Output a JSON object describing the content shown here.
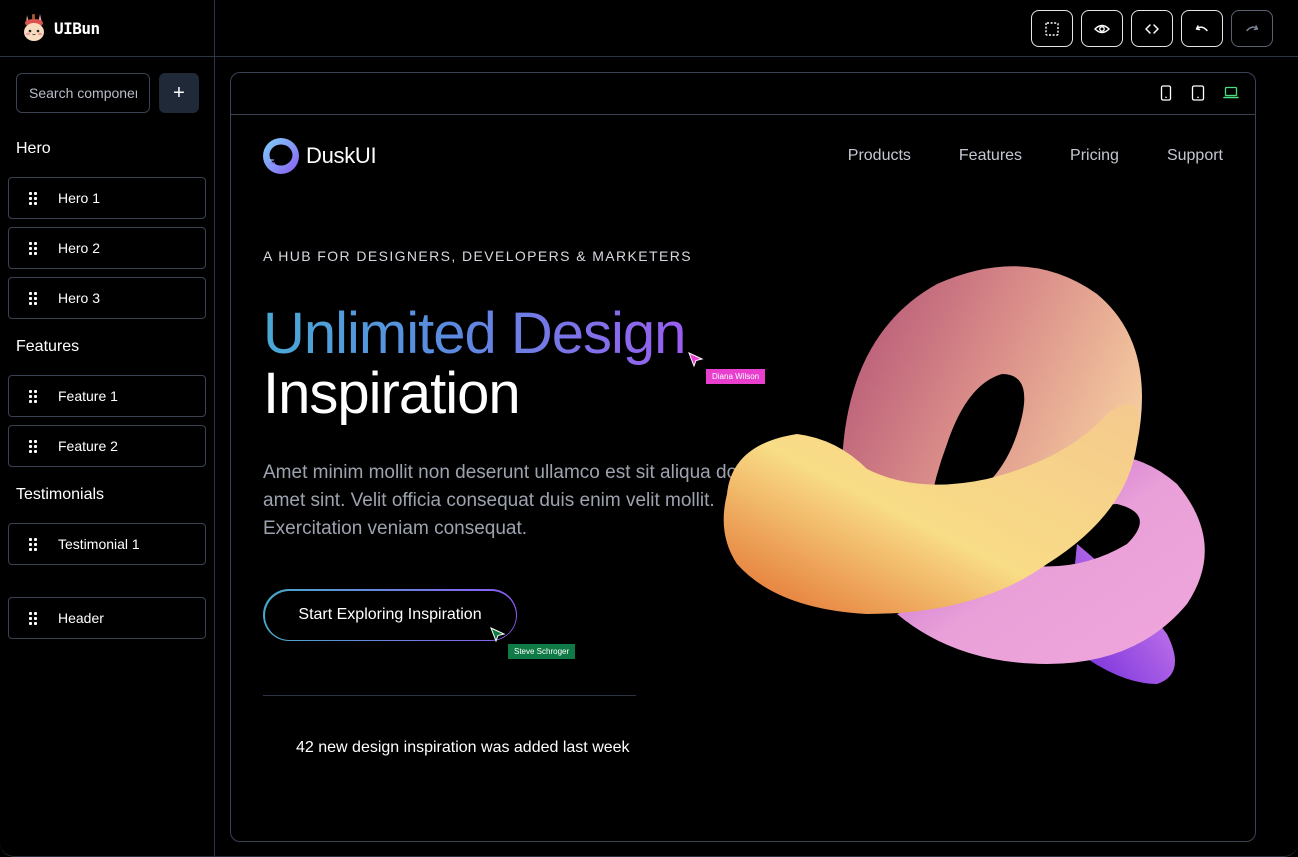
{
  "app": {
    "name": "UIBun",
    "logo_icon": "bunny-mascot-icon"
  },
  "toolbar": {
    "buttons": [
      {
        "name": "select-tool",
        "icon": "dashed-square-icon",
        "enabled": true
      },
      {
        "name": "preview",
        "icon": "eye-icon",
        "enabled": true
      },
      {
        "name": "code",
        "icon": "code-brackets-icon",
        "enabled": true
      },
      {
        "name": "undo",
        "icon": "undo-icon",
        "enabled": true
      },
      {
        "name": "redo",
        "icon": "redo-icon",
        "enabled": false
      }
    ]
  },
  "sidebar": {
    "search": {
      "placeholder": "Search components",
      "value": ""
    },
    "add_label": "+",
    "sections": [
      {
        "title": "Hero",
        "items": [
          "Hero 1",
          "Hero 2",
          "Hero 3"
        ]
      },
      {
        "title": "Features",
        "items": [
          "Feature 1",
          "Feature 2"
        ]
      },
      {
        "title": "Testimonials",
        "items": [
          "Testimonial 1"
        ]
      },
      {
        "title": "",
        "items": [
          "Header"
        ]
      }
    ]
  },
  "preview": {
    "devices": [
      {
        "name": "mobile",
        "icon": "phone-icon",
        "active": false
      },
      {
        "name": "tablet",
        "icon": "tablet-icon",
        "active": false
      },
      {
        "name": "desktop",
        "icon": "laptop-icon",
        "active": true
      }
    ],
    "active_color": "#4ade80",
    "site": {
      "logo_name": "DuskUI",
      "nav": [
        "Products",
        "Features",
        "Pricing",
        "Support"
      ],
      "eyebrow": "A HUB FOR DESIGNERS, DEVELOPERS & MARKETERS",
      "headline_gradient": "Unlimited Design",
      "headline_plain": "Inspiration",
      "lead": "Amet minim mollit non deserunt ullamco est sit aliqua dolor do amet sint. Velit officia consequat duis enim velit mollit. Exercitation veniam consequat.",
      "cta_label": "Start Exploring Inspiration",
      "stat": "42 new design inspiration was added last week"
    },
    "collaborators": [
      {
        "name": "Diana Wilson",
        "color": "#e83fcf"
      },
      {
        "name": "Steve Schroger",
        "color": "#0f7a45"
      }
    ]
  }
}
